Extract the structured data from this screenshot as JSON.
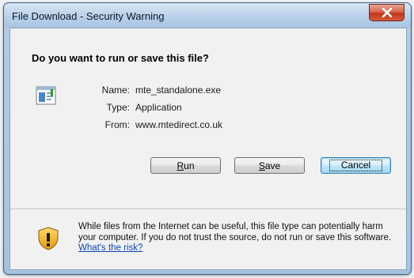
{
  "window": {
    "title": "File Download - Security Warning"
  },
  "dialog": {
    "question": "Do you want to run or save this file?",
    "fields": [
      {
        "label": "Name:",
        "value": "mte_standalone.exe"
      },
      {
        "label": "Type:",
        "value": "Application"
      },
      {
        "label": "From:",
        "value": "www.mtedirect.co.uk"
      }
    ],
    "buttons": {
      "run_label": "Run",
      "run_accesskey_char": "R",
      "run_rest": "un",
      "save_label": "Save",
      "save_accesskey_char": "S",
      "save_rest": "ave",
      "cancel_label": "Cancel"
    }
  },
  "footer": {
    "warning_text": "While files from the Internet can be useful, this file type can potentially harm your computer. If you do not trust the source, do not run or save this software.",
    "risk_link": "What's the risk?"
  },
  "icons": {
    "close": "close-icon",
    "file": "application-file-icon",
    "shield": "warning-shield-icon"
  }
}
